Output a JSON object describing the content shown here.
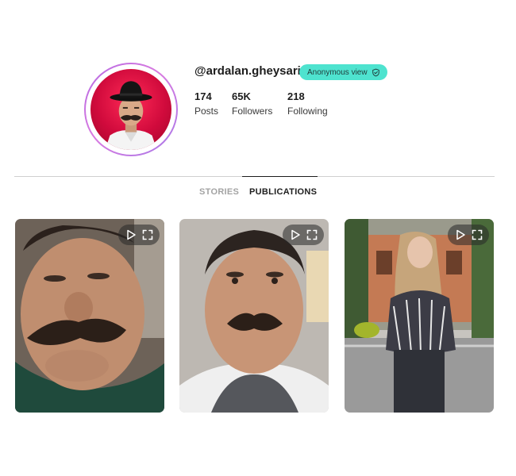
{
  "profile": {
    "username": "@ardalan.gheysari",
    "badge_label": "Anonymous view",
    "stats": [
      {
        "value": "174",
        "label": "Posts"
      },
      {
        "value": "65K",
        "label": "Followers"
      },
      {
        "value": "218",
        "label": "Following"
      }
    ]
  },
  "tabs": [
    {
      "label": "STORIES",
      "active": false
    },
    {
      "label": "PUBLICATIONS",
      "active": true
    }
  ],
  "posts": [
    {
      "type": "video",
      "icons": [
        "play-icon",
        "fullscreen-icon"
      ]
    },
    {
      "type": "video",
      "icons": [
        "play-icon",
        "fullscreen-icon"
      ]
    },
    {
      "type": "video",
      "icons": [
        "play-icon",
        "fullscreen-icon"
      ]
    }
  ],
  "colors": {
    "badge_bg": "#4ee3cf",
    "avatar_bg": "#e01243",
    "ring": "#b46be3",
    "active_tab": "#1d1d1d",
    "inactive_tab": "#a3a3a3"
  }
}
